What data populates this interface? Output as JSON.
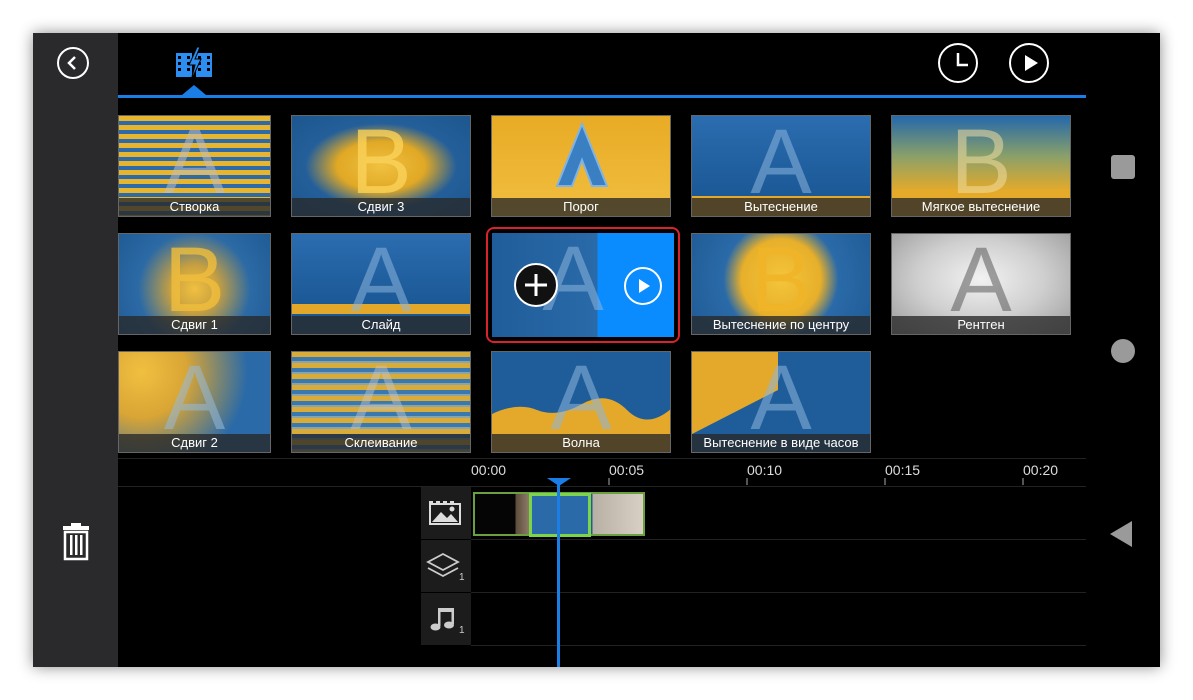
{
  "header": {
    "back_icon": "chevron-left-icon",
    "tab_icon": "transitions-film-icon",
    "duration_icon": "clock-icon",
    "preview_icon": "play-icon",
    "accent": "#1a7ee6"
  },
  "transitions": [
    {
      "label": "Створка"
    },
    {
      "label": "Сдвиг 3"
    },
    {
      "label": "Порог"
    },
    {
      "label": "Вытеснение"
    },
    {
      "label": "Мягкое вытеснение"
    },
    {
      "label": "Сдвиг 1"
    },
    {
      "label": "Слайд"
    },
    {
      "label": "Вытеснение по центру"
    },
    {
      "label": "Рентген"
    },
    {
      "label": "Сдвиг 2"
    },
    {
      "label": "Склеивание"
    },
    {
      "label": "Волна"
    },
    {
      "label": "Вытеснение в виде часов"
    }
  ],
  "selected_tile": {
    "add_icon": "plus-circle-icon",
    "play_icon": "play-circle-icon",
    "highlight_color": "#d8232a"
  },
  "timeline": {
    "ticks": [
      "00:00",
      "00:05",
      "00:10",
      "00:15",
      "00:20"
    ],
    "tracks": [
      {
        "icon": "image-track-icon",
        "count": ""
      },
      {
        "icon": "layers-icon",
        "count": "1"
      },
      {
        "icon": "music-note-icon",
        "count": "1"
      }
    ]
  },
  "side": {
    "stop_icon": "square-icon",
    "home_icon": "circle-icon",
    "back_icon": "triangle-back-icon",
    "delete_icon": "trash-icon"
  }
}
